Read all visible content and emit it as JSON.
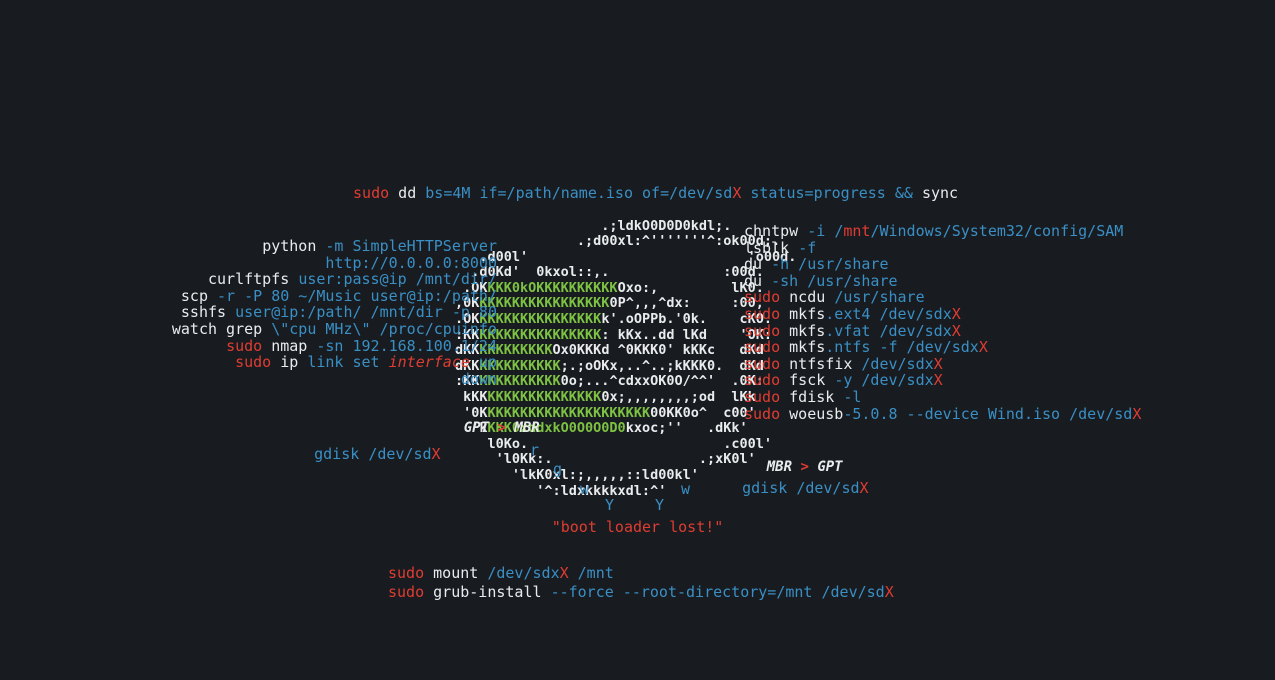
{
  "theme": {
    "background": "#181c21",
    "white": "#e9ebec",
    "blue": "#3a8fc4",
    "red": "#e03c31",
    "green": "#7dc242"
  },
  "header": {
    "dd_command": {
      "sudo": "sudo",
      "cmd": " dd ",
      "args": "bs=4M if=/path/name.iso of=/dev/sd",
      "x": "X",
      "tail": " status=progress && ",
      "sync": "sync"
    }
  },
  "left_column": [
    {
      "id": "python-http",
      "segments": [
        {
          "text": "python ",
          "color": "white"
        },
        {
          "text": "-m ",
          "color": "blue"
        },
        {
          "text": "SimpleHTTPServer",
          "color": "blue"
        }
      ]
    },
    {
      "id": "http-url",
      "segments": [
        {
          "text": "http://0.0.0.0:8000",
          "color": "blue"
        }
      ]
    },
    {
      "id": "curlftpfs",
      "segments": [
        {
          "text": "curlftpfs ",
          "color": "white"
        },
        {
          "text": "user:pass@ip /mnt/dir/",
          "color": "blue"
        }
      ]
    },
    {
      "id": "scp",
      "segments": [
        {
          "text": "scp ",
          "color": "white"
        },
        {
          "text": "-r -P 80 ~/Music user@ip:/path/",
          "color": "blue"
        }
      ]
    },
    {
      "id": "sshfs",
      "segments": [
        {
          "text": "sshfs ",
          "color": "white"
        },
        {
          "text": "user@ip:/path/ /mnt/dir -p 80",
          "color": "blue"
        }
      ]
    },
    {
      "id": "watch-grep",
      "segments": [
        {
          "text": "watch grep ",
          "color": "white"
        },
        {
          "text": "\\\"cpu MHz\\\" /proc/cpuinfo",
          "color": "blue"
        }
      ]
    },
    {
      "id": "nmap",
      "segments": [
        {
          "text": "sudo ",
          "color": "red"
        },
        {
          "text": "nmap ",
          "color": "white"
        },
        {
          "text": "-sn 192.168.100.1/24",
          "color": "blue"
        }
      ]
    },
    {
      "id": "ip-link-set",
      "segments": [
        {
          "text": "sudo ",
          "color": "red"
        },
        {
          "text": "ip ",
          "color": "white"
        },
        {
          "text": "link set ",
          "color": "blue"
        },
        {
          "text": "interface",
          "color": "red",
          "italic": true
        },
        {
          "text": " up",
          "color": "blue"
        }
      ]
    },
    {
      "id": "ip-link-down",
      "segments": [
        {
          "text": "down",
          "color": "blue"
        }
      ]
    }
  ],
  "right_column": [
    {
      "id": "chntpw",
      "segments": [
        {
          "text": "chntpw ",
          "color": "white"
        },
        {
          "text": "-i ",
          "color": "blue"
        },
        {
          "text": "/",
          "color": "blue"
        },
        {
          "text": "mnt",
          "color": "red"
        },
        {
          "text": "/Windows/System32/config/SAM",
          "color": "blue"
        }
      ]
    },
    {
      "id": "lsblk",
      "segments": [
        {
          "text": "lsblk ",
          "color": "white"
        },
        {
          "text": "-f",
          "color": "blue"
        }
      ]
    },
    {
      "id": "du-h",
      "segments": [
        {
          "text": "du ",
          "color": "white"
        },
        {
          "text": "-h /usr/share",
          "color": "blue"
        }
      ]
    },
    {
      "id": "du-sh",
      "segments": [
        {
          "text": "du ",
          "color": "white"
        },
        {
          "text": "-sh /usr/share",
          "color": "blue"
        }
      ]
    },
    {
      "id": "ncdu",
      "segments": [
        {
          "text": "sudo ",
          "color": "red"
        },
        {
          "text": "ncdu ",
          "color": "white"
        },
        {
          "text": "/usr/share",
          "color": "blue"
        }
      ]
    },
    {
      "id": "mkfs-ext4",
      "segments": [
        {
          "text": "sudo ",
          "color": "red"
        },
        {
          "text": "mkfs",
          "color": "white"
        },
        {
          "text": ".ext4 /dev/sd",
          "color": "blue"
        },
        {
          "text": "x",
          "color": "blue"
        },
        {
          "text": "X",
          "color": "red"
        }
      ]
    },
    {
      "id": "mkfs-vfat",
      "segments": [
        {
          "text": "sudo ",
          "color": "red"
        },
        {
          "text": "mkfs",
          "color": "white"
        },
        {
          "text": ".vfat /dev/sd",
          "color": "blue"
        },
        {
          "text": "x",
          "color": "blue"
        },
        {
          "text": "X",
          "color": "red"
        }
      ]
    },
    {
      "id": "mkfs-ntfs",
      "segments": [
        {
          "text": "sudo ",
          "color": "red"
        },
        {
          "text": "mkfs",
          "color": "white"
        },
        {
          "text": ".ntfs -f /dev/sd",
          "color": "blue"
        },
        {
          "text": "x",
          "color": "blue"
        },
        {
          "text": "X",
          "color": "red"
        }
      ]
    },
    {
      "id": "ntfsfix",
      "segments": [
        {
          "text": "sudo ",
          "color": "red"
        },
        {
          "text": "ntfsfix ",
          "color": "white"
        },
        {
          "text": "/dev/sd",
          "color": "blue"
        },
        {
          "text": "x",
          "color": "blue"
        },
        {
          "text": "X",
          "color": "red"
        }
      ]
    },
    {
      "id": "fsck",
      "segments": [
        {
          "text": "sudo ",
          "color": "red"
        },
        {
          "text": "fsck ",
          "color": "white"
        },
        {
          "text": "-y /dev/sd",
          "color": "blue"
        },
        {
          "text": "x",
          "color": "blue"
        },
        {
          "text": "X",
          "color": "red"
        }
      ]
    },
    {
      "id": "fdisk",
      "segments": [
        {
          "text": "sudo ",
          "color": "red"
        },
        {
          "text": "fdisk ",
          "color": "white"
        },
        {
          "text": "-l",
          "color": "blue"
        }
      ]
    },
    {
      "id": "woeusb",
      "segments": [
        {
          "text": "sudo ",
          "color": "red"
        },
        {
          "text": "woeusb",
          "color": "white"
        },
        {
          "text": "-5.0.8 --device Wind.iso /dev/sd",
          "color": "blue"
        },
        {
          "text": "X",
          "color": "red"
        }
      ]
    }
  ],
  "labels": {
    "gpt_to_mbr": {
      "a": "GPT",
      "arrow": " > ",
      "b": "MBR"
    },
    "mbr_to_gpt": {
      "a": "MBR",
      "arrow": " > ",
      "b": "GPT"
    },
    "gdisk_left": {
      "cmd": "gdisk ",
      "path": "/dev/sd",
      "x": "X"
    },
    "gdisk_right": {
      "cmd": "gdisk ",
      "path": "/dev/sd",
      "x": "X"
    },
    "boot_loader_lost": "\"boot loader lost!\""
  },
  "bottom": [
    {
      "id": "mount",
      "segments": [
        {
          "text": "sudo ",
          "color": "red"
        },
        {
          "text": "mount ",
          "color": "white"
        },
        {
          "text": "/dev/sd",
          "color": "blue"
        },
        {
          "text": "x",
          "color": "blue"
        },
        {
          "text": "X",
          "color": "red"
        },
        {
          "text": " /mnt",
          "color": "blue"
        }
      ]
    },
    {
      "id": "grub-install",
      "segments": [
        {
          "text": "sudo ",
          "color": "red"
        },
        {
          "text": "grub-install ",
          "color": "white"
        },
        {
          "text": "--force --root-directory=/mnt /dev/sd",
          "color": "blue"
        },
        {
          "text": "X",
          "color": "red"
        }
      ]
    }
  ],
  "tux_ascii": [
    "                  .;ldkO0D0D0kdl;.",
    "               .;d00xl:^'''''''^:ok00d;.",
    "   .d00l'                           'o00d.",
    "  .d0Kd'  0kxol::,.              :00d.",
    " .OK{g}KKK0kOKKKKKKKKKK{/g}Oxo:,         lK0.",
    ",0K{g}KKKKKKKKKKKKKKKK{/g}0P^,,,^dx:     :00,",
    ".OK{g}KKKKKKKKKKKKKKK{/g}k'.oOPPb.'0k.    cKO.",
    ":KK{g}KKKKKKKKKKKKKKK{/g}: kKx..dd lKd    'OK:",
    "dKK{g}KKKKKKKKK{/g}Ox0KKKd ^0KKK0' kKKc   dKd",
    "dKK{g}KKKKKKKKKK{/g};.;oOKx,..^..;kKKK0.  dKd",
    ":KK{g}KKKKKKKKKK{/g}0o;...^cdxxOK0O/^^'  .0K:",
    " kKK{g}KKKKKKKKKKKKKK{/g}0x;,,,,,,,,;od  lKk",
    " '0K{g}KKKKKKKKKKKKKKKKKKKK{/g}00KK0o^  c00'",
    "  'k{g}KKK0xddxkO0O0O0D0{/g}kxoc;''   .dKk'",
    "    l0Ko.                        .c00l'",
    "     'l0Kk:.                  .;xK0l'",
    "       'lkK0xl:;,,,,,::ld00kl'",
    "          '^:ldxkkkkxdl:^'"
  ],
  "tux_legs": {
    "r": "r",
    "g": "g",
    "w1": "w",
    "w2": "w",
    "y1": "Y",
    "y2": "Y"
  }
}
